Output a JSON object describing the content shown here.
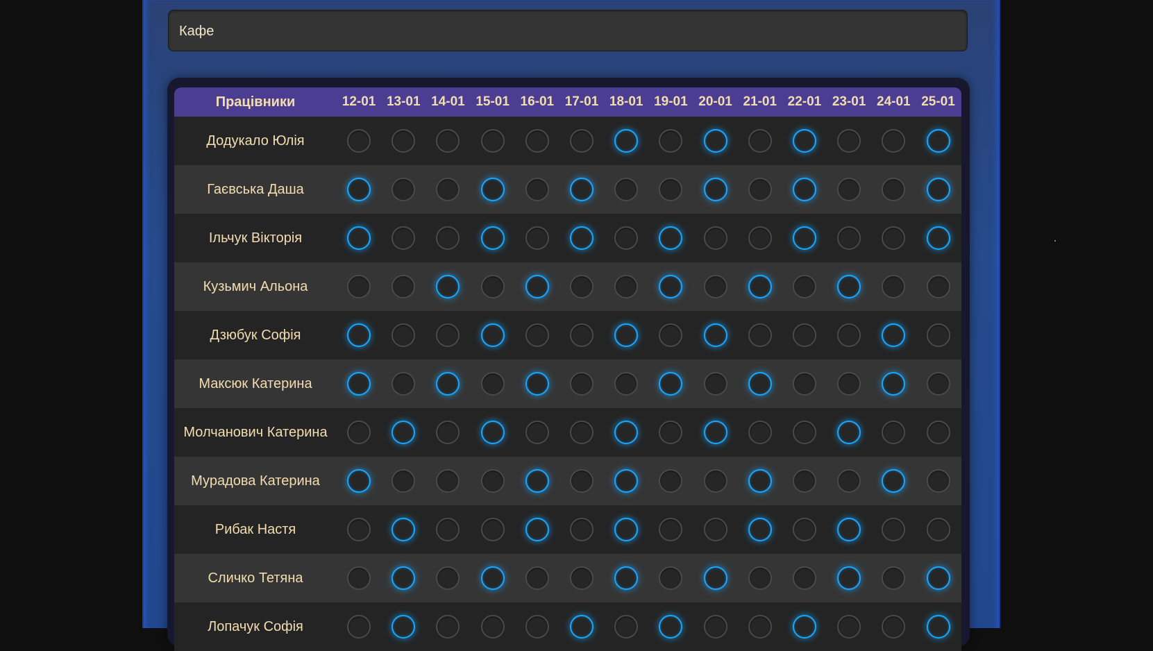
{
  "location": {
    "value": "Кафе"
  },
  "table": {
    "name_header": "Працівники",
    "dates": [
      "12-01",
      "13-01",
      "14-01",
      "15-01",
      "16-01",
      "17-01",
      "18-01",
      "19-01",
      "20-01",
      "21-01",
      "22-01",
      "23-01",
      "24-01",
      "25-01"
    ],
    "employees": [
      {
        "name": "Додукало Юлія",
        "shifts": [
          0,
          0,
          0,
          0,
          0,
          0,
          1,
          0,
          1,
          0,
          1,
          0,
          0,
          1
        ]
      },
      {
        "name": "Гаєвська Даша",
        "shifts": [
          1,
          0,
          0,
          1,
          0,
          1,
          0,
          0,
          1,
          0,
          1,
          0,
          0,
          1
        ]
      },
      {
        "name": "Ільчук Вікторія",
        "shifts": [
          1,
          0,
          0,
          1,
          0,
          1,
          0,
          1,
          0,
          0,
          1,
          0,
          0,
          1
        ]
      },
      {
        "name": "Кузьмич Альона",
        "shifts": [
          0,
          0,
          1,
          0,
          1,
          0,
          0,
          1,
          0,
          1,
          0,
          1,
          0,
          0
        ]
      },
      {
        "name": "Дзюбук Софія",
        "shifts": [
          1,
          0,
          0,
          1,
          0,
          0,
          1,
          0,
          1,
          0,
          0,
          0,
          1,
          0
        ]
      },
      {
        "name": "Максюк Катерина",
        "shifts": [
          1,
          0,
          1,
          0,
          1,
          0,
          0,
          1,
          0,
          1,
          0,
          0,
          1,
          0
        ]
      },
      {
        "name": "Молчанович Катерина",
        "shifts": [
          0,
          1,
          0,
          1,
          0,
          0,
          1,
          0,
          1,
          0,
          0,
          1,
          0,
          0
        ]
      },
      {
        "name": "Мурадова Катерина",
        "shifts": [
          1,
          0,
          0,
          0,
          1,
          0,
          1,
          0,
          0,
          1,
          0,
          0,
          1,
          0
        ]
      },
      {
        "name": "Рибак Настя",
        "shifts": [
          0,
          1,
          0,
          0,
          1,
          0,
          1,
          0,
          0,
          1,
          0,
          1,
          0,
          0
        ]
      },
      {
        "name": "Сличко Тетяна",
        "shifts": [
          0,
          1,
          0,
          1,
          0,
          0,
          1,
          0,
          1,
          0,
          0,
          1,
          0,
          1
        ]
      },
      {
        "name": "Лопачук Софія",
        "shifts": [
          0,
          1,
          0,
          0,
          0,
          1,
          0,
          1,
          0,
          0,
          1,
          0,
          0,
          1
        ]
      }
    ]
  },
  "colors": {
    "active_ring": "#18a6ff",
    "inactive_ring": "#4a4a4a",
    "header_bg": "#4b3e92",
    "text": "#f3ddb0"
  }
}
